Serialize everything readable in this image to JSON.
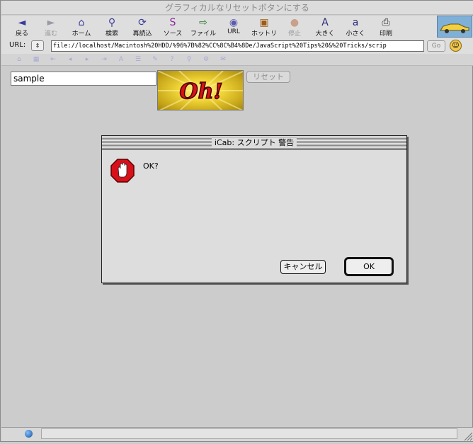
{
  "window": {
    "title": "グラフィカルなリセットボタンにする"
  },
  "toolbar": {
    "buttons": [
      {
        "id": "back",
        "label": "戻る",
        "icon": "back-arrow-icon",
        "glyph": "◄",
        "color": "#3a3a9a",
        "disabled": false
      },
      {
        "id": "forward",
        "label": "進む",
        "icon": "forward-arrow-icon",
        "glyph": "►",
        "color": "#9a9aaa",
        "disabled": true
      },
      {
        "id": "home",
        "label": "ホーム",
        "icon": "home-icon",
        "glyph": "⌂",
        "color": "#3a3a9a",
        "disabled": false
      },
      {
        "id": "search",
        "label": "検索",
        "icon": "search-icon",
        "glyph": "⚲",
        "color": "#3a3a9a",
        "disabled": false
      },
      {
        "id": "reload",
        "label": "再読込",
        "icon": "reload-icon",
        "glyph": "⟳",
        "color": "#3a3a9a",
        "disabled": false
      },
      {
        "id": "source",
        "label": "ソース",
        "icon": "source-icon",
        "glyph": "S",
        "color": "#8a2a9a",
        "disabled": false
      },
      {
        "id": "file",
        "label": "ファイル",
        "icon": "file-icon",
        "glyph": "⇨",
        "color": "#2a7a2a",
        "disabled": false
      },
      {
        "id": "url",
        "label": "URL",
        "icon": "url-icon",
        "glyph": "◉",
        "color": "#5a5ab0",
        "disabled": false
      },
      {
        "id": "hotlist",
        "label": "ホットリスト",
        "icon": "hotlist-icon",
        "glyph": "▣",
        "color": "#a05a10",
        "disabled": false
      },
      {
        "id": "stop",
        "label": "停止",
        "icon": "stop-icon",
        "glyph": "●",
        "color": "#c9a08a",
        "disabled": true
      },
      {
        "id": "larger",
        "label": "大きく",
        "icon": "larger-text-icon",
        "glyph": "A",
        "color": "#2a2a7a",
        "disabled": false
      },
      {
        "id": "smaller",
        "label": "小さく",
        "icon": "smaller-text-icon",
        "glyph": "a",
        "color": "#2a2a7a",
        "disabled": false
      },
      {
        "id": "print",
        "label": "印刷",
        "icon": "print-icon",
        "glyph": "⎙",
        "color": "#2a2a2a",
        "disabled": false
      }
    ],
    "logo_icon": "car-logo-icon"
  },
  "urlbar": {
    "label": "URL:",
    "value": "file://localhost/Macintosh%20HDD/%96%7B%82%CC%8C%B4%8De/JavaScript%20Tips%20&%20Tricks/scrip",
    "go_label": "Go",
    "stepper_glyph": "⇕",
    "smiley_glyph": "☺"
  },
  "navbar2": {
    "icons": [
      "home-icon",
      "grid-icon",
      "first-icon",
      "prev-icon",
      "next-icon",
      "last-icon",
      "font-icon",
      "index-icon",
      "edit-icon",
      "help-icon",
      "search-icon",
      "gear-icon",
      "mail-icon"
    ]
  },
  "page": {
    "input_value": "sample",
    "image_text": "Oh!",
    "reset_label": "リセット"
  },
  "dialog": {
    "title": "iCab: スクリプト 警告",
    "message": "OK?",
    "cancel_label": "キャンセル",
    "ok_label": "OK"
  }
}
